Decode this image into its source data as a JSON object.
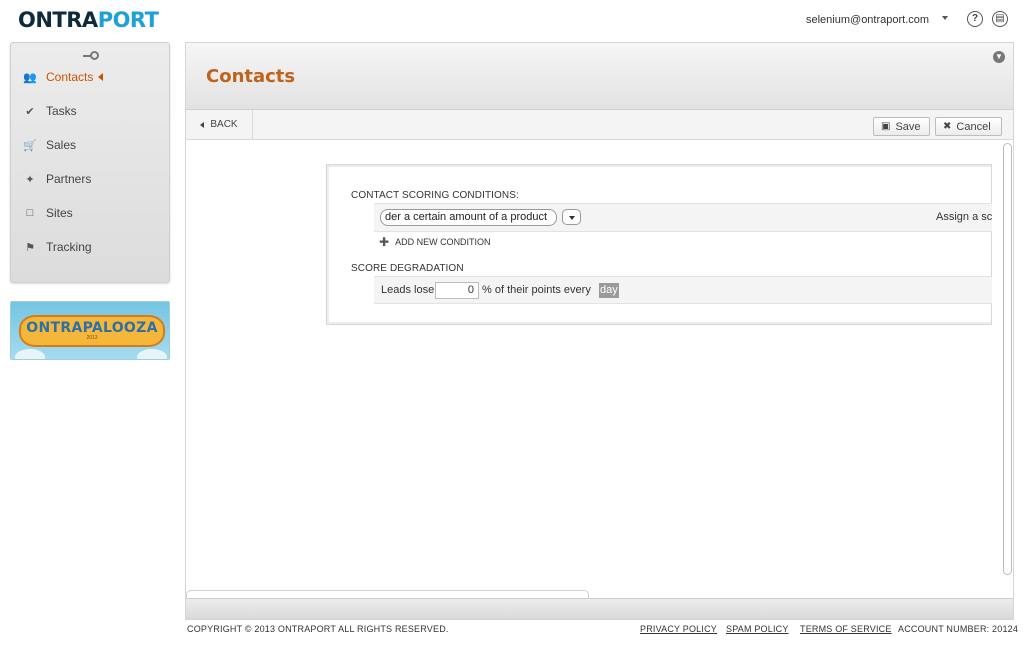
{
  "header": {
    "logo_part1": "ONTRA",
    "logo_part2": "PORT",
    "user_email": "selenium@ontraport.com",
    "help_icon": "?",
    "doc_icon": "▤"
  },
  "sidebar": {
    "items": [
      {
        "label": "Contacts",
        "icon": "contacts-icon",
        "glyph": "👥",
        "active": true
      },
      {
        "label": "Tasks",
        "icon": "check-icon",
        "glyph": "✔"
      },
      {
        "label": "Sales",
        "icon": "cart-icon",
        "glyph": "🛒"
      },
      {
        "label": "Partners",
        "icon": "handshake-icon",
        "glyph": "✦"
      },
      {
        "label": "Sites",
        "icon": "page-icon",
        "glyph": "□"
      },
      {
        "label": "Tracking",
        "icon": "flag-icon",
        "glyph": "⚑"
      }
    ],
    "promo": {
      "title": "ONTRAPALOOZA",
      "year": "2013"
    }
  },
  "main": {
    "title": "Contacts",
    "toolbar": {
      "back_label": "BACK",
      "save_label": "Save",
      "cancel_label": "Cancel"
    },
    "scoring": {
      "conditions_label": "CONTACT SCORING CONDITIONS:",
      "condition_value": "der a certain amount of a product",
      "assign_text": "Assign a sc",
      "add_condition_label": "ADD NEW CONDITION"
    },
    "degradation": {
      "label": "SCORE DEGRADATION",
      "prefix": "Leads lose",
      "value": "0",
      "suffix": "% of their points every",
      "period": "day"
    }
  },
  "footer": {
    "copyright": "COPYRIGHT © 2013 ONTRAPORT ALL RIGHTS RESERVED.",
    "privacy": "PRIVACY POLICY",
    "spam": "SPAM POLICY",
    "terms": "TERMS OF SERVICE",
    "account": "ACCOUNT NUMBER: 20124"
  },
  "colors": {
    "accent": "#c1621b",
    "logo_dark": "#0f2a3a",
    "logo_blue": "#1ea0d8"
  }
}
